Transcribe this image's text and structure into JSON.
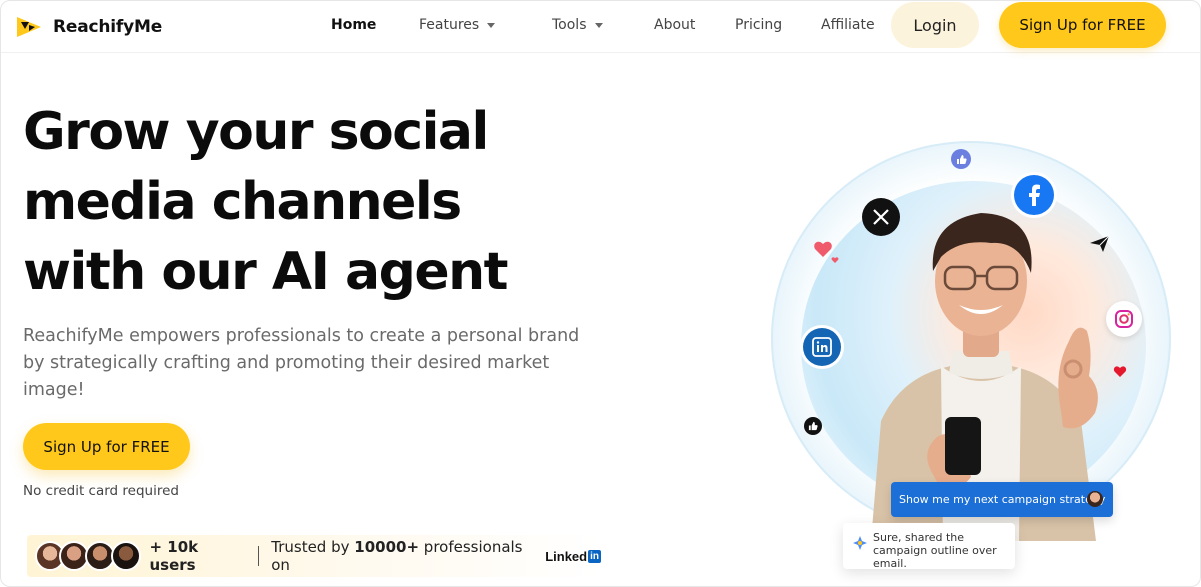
{
  "app": {
    "name": "ReachifyMe"
  },
  "nav": {
    "links": [
      {
        "label": "Home",
        "active": true
      },
      {
        "label": "Features",
        "dropdown": true
      },
      {
        "label": "Tools",
        "dropdown": true
      },
      {
        "label": "About"
      },
      {
        "label": "Pricing"
      },
      {
        "label": "Affiliate"
      }
    ],
    "login_label": "Login",
    "signup_label": "Sign Up for FREE"
  },
  "hero": {
    "headline": [
      "Grow your social",
      "media channels",
      "with our AI agent"
    ],
    "subtext": "ReachifyMe empowers professionals to create a personal brand by strategically crafting and promoting their desired market image!",
    "cta_label": "Sign Up for FREE",
    "note": "No credit card required"
  },
  "trust": {
    "users": "+ 10k users",
    "text_prefix": "Trusted by ",
    "text_bold": "10000+",
    "text_suffix": " professionals on",
    "linkedin_word": "Linked",
    "linkedin_in": "in"
  },
  "chat": {
    "user_message": "Show me my next campaign strategy",
    "ai_reply": "Sure, shared the campaign outline over email."
  },
  "icons": [
    "x-twitter-icon",
    "facebook-icon",
    "linkedin-icon",
    "instagram-icon",
    "heart-icon",
    "thumbs-up-icon"
  ],
  "colors": {
    "brand_yellow": "#ffc81a",
    "login_bg": "#fbf3dc",
    "facebook_blue": "#1877f2",
    "linkedin_blue": "#0a66c2",
    "chat_blue": "#1c6fd6"
  }
}
